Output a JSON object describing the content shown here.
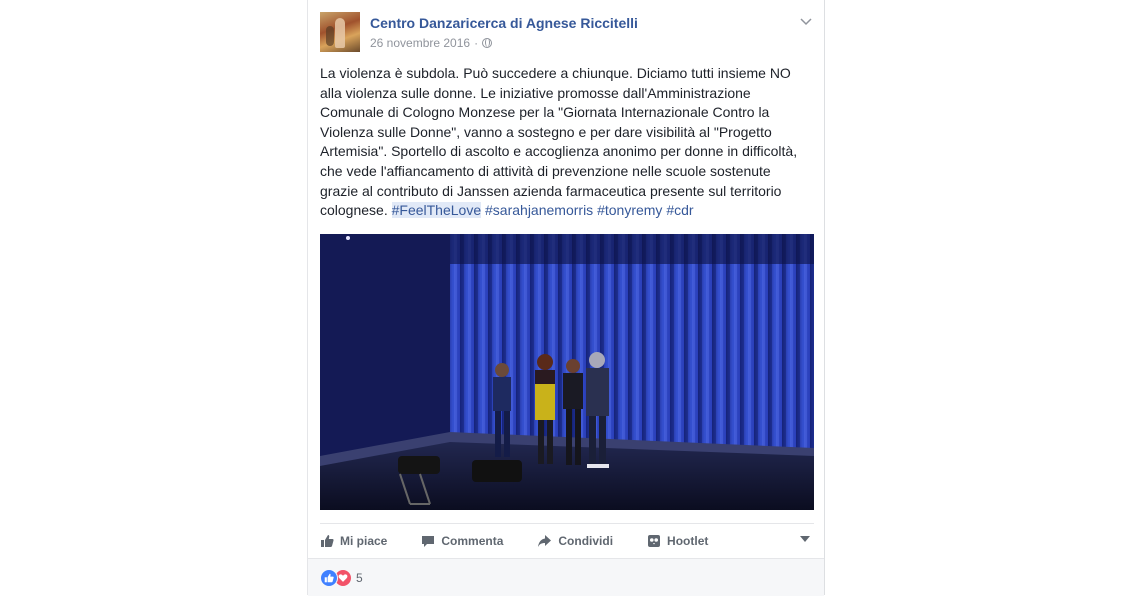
{
  "post": {
    "author": "Centro Danzaricerca di Agnese Riccitelli",
    "date": "26 novembre 2016",
    "separator": "·",
    "privacy_icon": "globe-icon",
    "menu_icon": "chevron-down-icon",
    "text": "La violenza è subdola. Può succedere a chiunque. Diciamo tutti insieme NO alla violenza sulle donne. Le iniziative promosse dall'Amministrazione Comunale di Cologno Monzese per la \"Giornata Internazionale Contro la Violenza sulle Donne\", vanno a sostegno e per dare visibilità al \"Progetto Artemisia\". Sportello di ascolto e accoglienza anonimo per donne in difficoltà, che vede l'affiancamento di attività di prevenzione nelle scuole sostenute grazie al contributo di Janssen azienda farmaceutica presente sul territorio colognese.",
    "hashtags": [
      "#FeelTheLove",
      "#sarahjanemorris",
      "#tonyremy",
      "#cdr"
    ]
  },
  "actions": {
    "like": "Mi piace",
    "comment": "Commenta",
    "share": "Condividi",
    "hootlet": "Hootlet"
  },
  "reactions": {
    "types": [
      "like",
      "love"
    ],
    "count": "5"
  },
  "colors": {
    "link": "#365899",
    "meta": "#90949c",
    "action": "#606770",
    "like": "#4080ff",
    "love": "#f25268",
    "footer_bg": "#f6f7f9"
  }
}
